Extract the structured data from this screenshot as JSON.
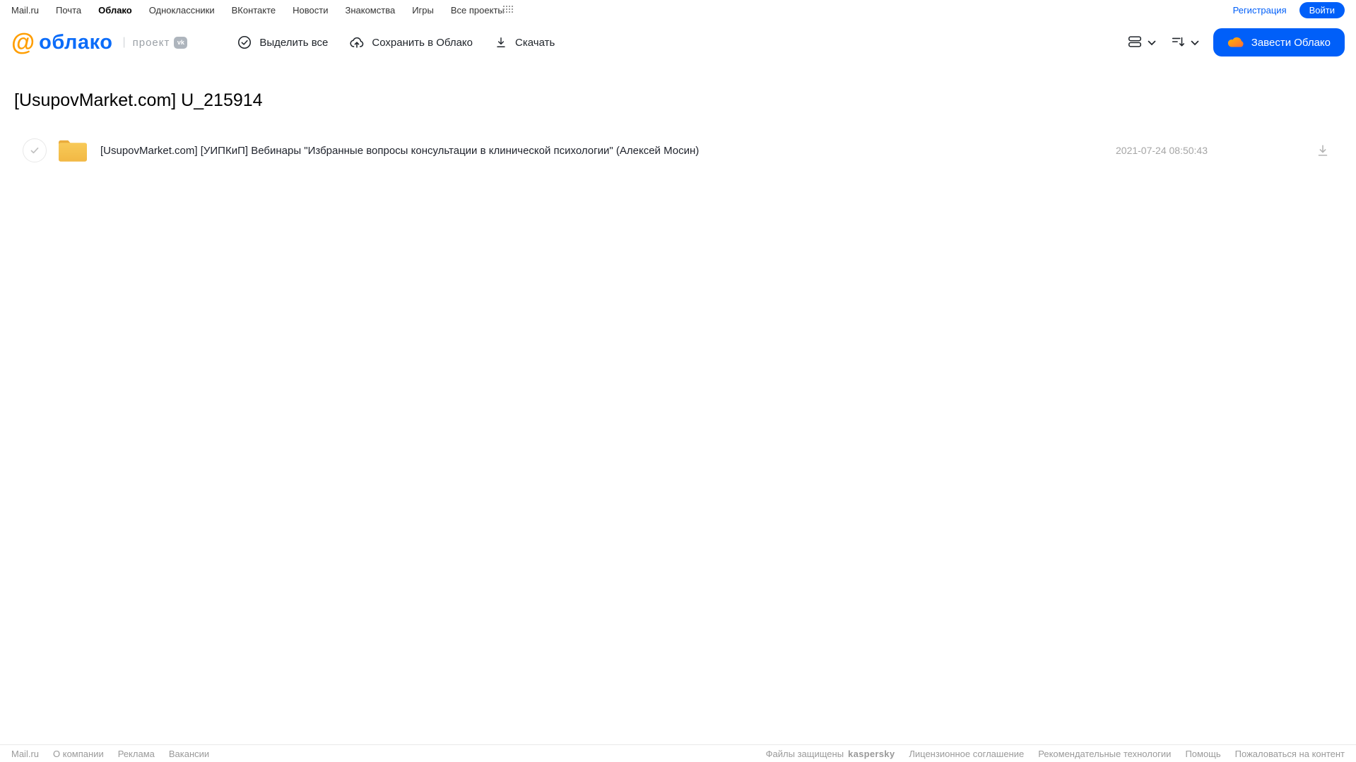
{
  "topnav": {
    "links": [
      "Mail.ru",
      "Почта",
      "Облако",
      "Одноклассники",
      "ВКонтакте",
      "Новости",
      "Знакомства",
      "Игры",
      "Все проекты"
    ],
    "active_link": "Облако",
    "registration_label": "Регистрация",
    "login_label": "Войти"
  },
  "header": {
    "logo_at": "@",
    "logo_word": "облако",
    "project_separator": "|",
    "project_label": "проект",
    "vk_badge": "vk",
    "toolbar": [
      {
        "label": "Выделить все",
        "icon": "check-circle-icon"
      },
      {
        "label": "Сохранить в Облако",
        "icon": "cloud-upload-icon"
      },
      {
        "label": "Скачать",
        "icon": "download-icon"
      }
    ],
    "view_button_icon": "view-mode-icon",
    "sort_button_icon": "sort-icon",
    "create_cloud_label": "Завести Облако"
  },
  "main": {
    "title": "[UsupovMarket.com] U_215914",
    "files": [
      {
        "type": "folder",
        "name": "[UsupovMarket.com] [УИПКиП] Вебинары \"Избранные вопросы консультации в клинической психологии\" (Алексей Мосин)",
        "date": "2021-07-24 08:50:43"
      }
    ]
  },
  "footer": {
    "left_links": [
      "Mail.ru",
      "О компании",
      "Реклама",
      "Вакансии"
    ],
    "protected_text": "Файлы защищены",
    "kaspersky_label": "kaspersky",
    "right_links": [
      "Лицензионное соглашение",
      "Рекомендательные технологии",
      "Помощь",
      "Пожаловаться на контент"
    ]
  },
  "colors": {
    "accent_blue": "#005ff9",
    "logo_orange": "#ff9e00",
    "folder_yellow": "#f5c04d",
    "kaspersky_green": "#00a88e",
    "muted_gray": "#9a9a9a"
  }
}
